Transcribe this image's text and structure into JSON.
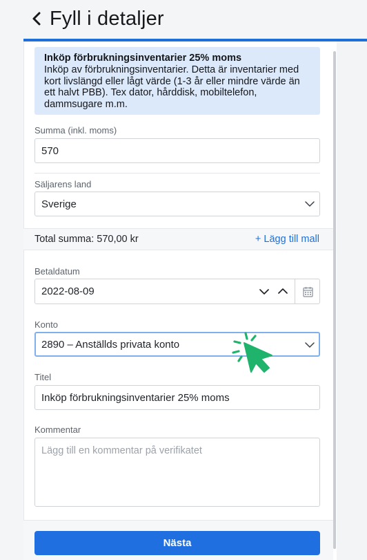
{
  "header": {
    "title": "Fyll i detaljer",
    "back_icon": "chevron-left-icon"
  },
  "info": {
    "title": "Inköp förbrukningsinventarier 25% moms",
    "lines": [
      "Inköp av förbrukningsinventarier. Detta är inventarier med",
      "kort livslängd eller lågt värde (1-3 år eller mindre värde än",
      "ett halvt PBB). Tex dator, hårddisk, mobiltelefon,",
      "dammsugare m.m."
    ]
  },
  "summa": {
    "label": "Summa (inkl. moms)",
    "value": "570"
  },
  "land": {
    "label": "Säljarens land",
    "value": "Sverige"
  },
  "total": {
    "text": "Total summa: 570,00 kr",
    "add_template": "+ Lägg till mall"
  },
  "betaldatum": {
    "label": "Betaldatum",
    "value": "2022-08-09"
  },
  "konto": {
    "label": "Konto",
    "value": "2890 – Anställds privata konto"
  },
  "titel": {
    "label": "Titel",
    "value": "Inköp förbrukningsinventarier 25% moms"
  },
  "kommentar": {
    "label": "Kommentar",
    "placeholder": "Lägg till en kommentar på verifikatet"
  },
  "next_button": {
    "label": "Nästa"
  },
  "colors": {
    "accent": "#1f6fe0",
    "info_bg": "#dbe9fb",
    "cursor": "#1fb36b"
  }
}
